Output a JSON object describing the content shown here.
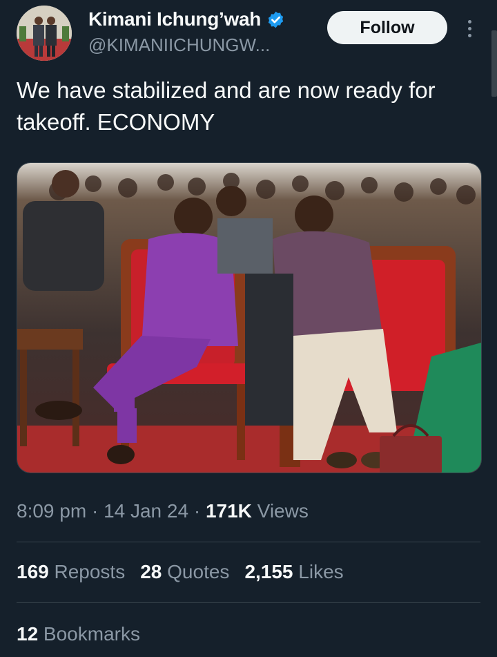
{
  "author": {
    "display_name": "Kimani Ichung’wah",
    "handle": "@KIMANIICHUNGW...",
    "verified_icon": "verified-badge-icon",
    "avatar_icon": "avatar-photo"
  },
  "header": {
    "follow_label": "Follow",
    "more_icon": "more-vertical-icon"
  },
  "tweet": {
    "text": "We have stabilized and are now ready for takeoff. ECONOMY",
    "media_description_icon": "photo"
  },
  "meta": {
    "time": "8:09 pm",
    "sep1": " · ",
    "date": "14 Jan 24",
    "sep2": " · ",
    "views_count": "171K",
    "views_label": " Views"
  },
  "stats": {
    "reposts_count": "169",
    "reposts_label": " Reposts",
    "quotes_count": "28",
    "quotes_label": " Quotes",
    "likes_count": "2,155",
    "likes_label": " Likes"
  },
  "bookmarks": {
    "count": "12",
    "label": " Bookmarks"
  },
  "colors": {
    "background": "#15202b",
    "text_primary": "#f7f9f9",
    "text_secondary": "#8b98a5",
    "verified_blue": "#1d9bf0",
    "follow_bg": "#eff3f4"
  }
}
